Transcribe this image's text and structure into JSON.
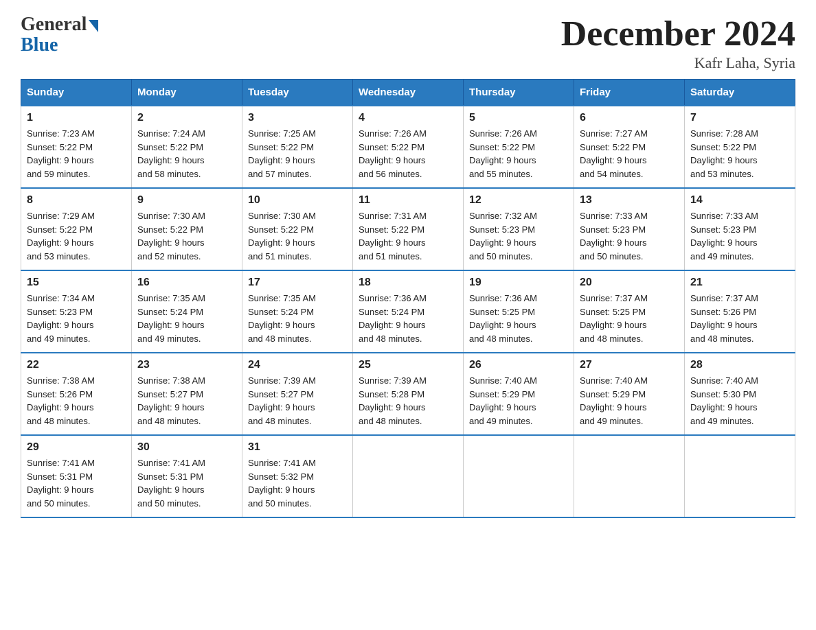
{
  "logo": {
    "general": "General",
    "blue": "Blue"
  },
  "title": "December 2024",
  "location": "Kafr Laha, Syria",
  "days_of_week": [
    "Sunday",
    "Monday",
    "Tuesday",
    "Wednesday",
    "Thursday",
    "Friday",
    "Saturday"
  ],
  "weeks": [
    [
      {
        "num": "1",
        "sunrise": "7:23 AM",
        "sunset": "5:22 PM",
        "daylight": "9 hours and 59 minutes."
      },
      {
        "num": "2",
        "sunrise": "7:24 AM",
        "sunset": "5:22 PM",
        "daylight": "9 hours and 58 minutes."
      },
      {
        "num": "3",
        "sunrise": "7:25 AM",
        "sunset": "5:22 PM",
        "daylight": "9 hours and 57 minutes."
      },
      {
        "num": "4",
        "sunrise": "7:26 AM",
        "sunset": "5:22 PM",
        "daylight": "9 hours and 56 minutes."
      },
      {
        "num": "5",
        "sunrise": "7:26 AM",
        "sunset": "5:22 PM",
        "daylight": "9 hours and 55 minutes."
      },
      {
        "num": "6",
        "sunrise": "7:27 AM",
        "sunset": "5:22 PM",
        "daylight": "9 hours and 54 minutes."
      },
      {
        "num": "7",
        "sunrise": "7:28 AM",
        "sunset": "5:22 PM",
        "daylight": "9 hours and 53 minutes."
      }
    ],
    [
      {
        "num": "8",
        "sunrise": "7:29 AM",
        "sunset": "5:22 PM",
        "daylight": "9 hours and 53 minutes."
      },
      {
        "num": "9",
        "sunrise": "7:30 AM",
        "sunset": "5:22 PM",
        "daylight": "9 hours and 52 minutes."
      },
      {
        "num": "10",
        "sunrise": "7:30 AM",
        "sunset": "5:22 PM",
        "daylight": "9 hours and 51 minutes."
      },
      {
        "num": "11",
        "sunrise": "7:31 AM",
        "sunset": "5:22 PM",
        "daylight": "9 hours and 51 minutes."
      },
      {
        "num": "12",
        "sunrise": "7:32 AM",
        "sunset": "5:23 PM",
        "daylight": "9 hours and 50 minutes."
      },
      {
        "num": "13",
        "sunrise": "7:33 AM",
        "sunset": "5:23 PM",
        "daylight": "9 hours and 50 minutes."
      },
      {
        "num": "14",
        "sunrise": "7:33 AM",
        "sunset": "5:23 PM",
        "daylight": "9 hours and 49 minutes."
      }
    ],
    [
      {
        "num": "15",
        "sunrise": "7:34 AM",
        "sunset": "5:23 PM",
        "daylight": "9 hours and 49 minutes."
      },
      {
        "num": "16",
        "sunrise": "7:35 AM",
        "sunset": "5:24 PM",
        "daylight": "9 hours and 49 minutes."
      },
      {
        "num": "17",
        "sunrise": "7:35 AM",
        "sunset": "5:24 PM",
        "daylight": "9 hours and 48 minutes."
      },
      {
        "num": "18",
        "sunrise": "7:36 AM",
        "sunset": "5:24 PM",
        "daylight": "9 hours and 48 minutes."
      },
      {
        "num": "19",
        "sunrise": "7:36 AM",
        "sunset": "5:25 PM",
        "daylight": "9 hours and 48 minutes."
      },
      {
        "num": "20",
        "sunrise": "7:37 AM",
        "sunset": "5:25 PM",
        "daylight": "9 hours and 48 minutes."
      },
      {
        "num": "21",
        "sunrise": "7:37 AM",
        "sunset": "5:26 PM",
        "daylight": "9 hours and 48 minutes."
      }
    ],
    [
      {
        "num": "22",
        "sunrise": "7:38 AM",
        "sunset": "5:26 PM",
        "daylight": "9 hours and 48 minutes."
      },
      {
        "num": "23",
        "sunrise": "7:38 AM",
        "sunset": "5:27 PM",
        "daylight": "9 hours and 48 minutes."
      },
      {
        "num": "24",
        "sunrise": "7:39 AM",
        "sunset": "5:27 PM",
        "daylight": "9 hours and 48 minutes."
      },
      {
        "num": "25",
        "sunrise": "7:39 AM",
        "sunset": "5:28 PM",
        "daylight": "9 hours and 48 minutes."
      },
      {
        "num": "26",
        "sunrise": "7:40 AM",
        "sunset": "5:29 PM",
        "daylight": "9 hours and 49 minutes."
      },
      {
        "num": "27",
        "sunrise": "7:40 AM",
        "sunset": "5:29 PM",
        "daylight": "9 hours and 49 minutes."
      },
      {
        "num": "28",
        "sunrise": "7:40 AM",
        "sunset": "5:30 PM",
        "daylight": "9 hours and 49 minutes."
      }
    ],
    [
      {
        "num": "29",
        "sunrise": "7:41 AM",
        "sunset": "5:31 PM",
        "daylight": "9 hours and 50 minutes."
      },
      {
        "num": "30",
        "sunrise": "7:41 AM",
        "sunset": "5:31 PM",
        "daylight": "9 hours and 50 minutes."
      },
      {
        "num": "31",
        "sunrise": "7:41 AM",
        "sunset": "5:32 PM",
        "daylight": "9 hours and 50 minutes."
      },
      null,
      null,
      null,
      null
    ]
  ],
  "labels": {
    "sunrise": "Sunrise: ",
    "sunset": "Sunset: ",
    "daylight": "Daylight: "
  }
}
